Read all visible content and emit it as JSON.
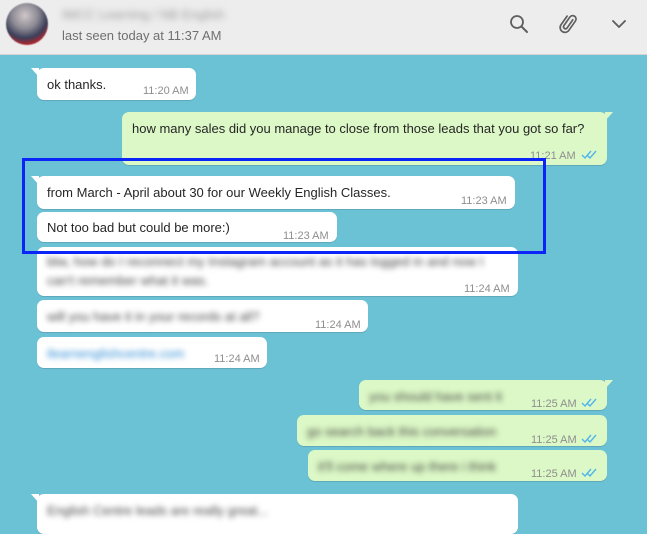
{
  "header": {
    "contact_name": "IMCC Learning / NB English",
    "last_seen": "last seen today at 11:37 AM"
  },
  "messages": [
    {
      "text": "ok thanks.",
      "time": "11:20 AM"
    },
    {
      "text": "how many sales did you manage to close from those leads that you got so far?",
      "time": "11:21 AM"
    },
    {
      "text": "from March - April about 30 for our Weekly English Classes.",
      "time": "11:23 AM"
    },
    {
      "text": "Not too bad but could be more:)",
      "time": "11:23 AM"
    },
    {
      "text": "btw, how do I reconnect my Instagram account as it has logged in and now I can't remember what it was.",
      "time": "11:24 AM"
    },
    {
      "text": "will you have it in your records at all?",
      "time": "11:24 AM"
    },
    {
      "text": "ilearnenglishcentre.com",
      "time": "11:24 AM"
    },
    {
      "text": "you should have sent it",
      "time": "11:25 AM"
    },
    {
      "text": "go search back this conversation",
      "time": "11:25 AM"
    },
    {
      "text": "it'll come where up there i think",
      "time": "11:25 AM"
    },
    {
      "text": "English Centre leads are really great...",
      "time": ""
    }
  ],
  "colors": {
    "chat_background": "#6cc2d5",
    "incoming_bubble": "#ffffff",
    "outgoing_bubble": "#dcf8c6",
    "read_ticks": "#4fb6ec",
    "annotation_box": "#0b24f7"
  },
  "icons": {
    "search": "search-icon",
    "attach": "paperclip-icon",
    "menu": "chevron-down-icon",
    "read_receipt": "double-check-icon"
  }
}
